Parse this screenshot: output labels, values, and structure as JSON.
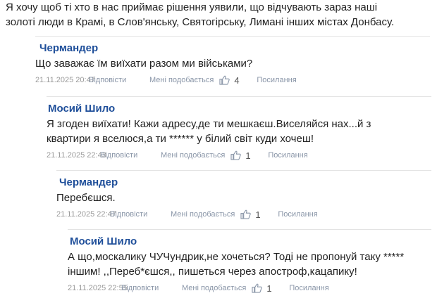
{
  "intro": {
    "line1": "Я хочу щоб ті хто в нас приймає рішення уявили, що відчувають зараз наші",
    "line2": "золоті люди в Крамі, в Слов'янську, Святогірську, Лимані інших містах Донбасу."
  },
  "comments": [
    {
      "author": "Чермандер",
      "lines": [
        "Що заважає їм виїхати разом ми військами?"
      ],
      "date": "21.11.2025 20:47",
      "reply": "Відповісти",
      "like": "Мені подобається",
      "likes": "4",
      "link": "Посилання"
    },
    {
      "author": "Мосий Шило",
      "lines": [
        "Я згоден виїхати! Кажи адресу,де ти мешкаєш.Виселяйся нах...й з",
        "квартири я вселюся,а ти ****** у білий світ куди хочеш!"
      ],
      "date": "21.11.2025 22:43",
      "reply": "Відповісти",
      "like": "Мені подобається",
      "likes": "1",
      "link": "Посилання"
    },
    {
      "author": "Чермандер",
      "lines": [
        "Перебєшся."
      ],
      "date": "21.11.2025 22:47",
      "reply": "Відповісти",
      "like": "Мені подобається",
      "likes": "1",
      "link": "Посилання"
    },
    {
      "author": "Мосий Шило",
      "lines": [
        "А що,москалику ЧУЧундрик,не хочеться? Тоді не пропонуй таку *****",
        "іншим! ,,Переб*єшся,, пишеться через апостроф,кацапику!"
      ],
      "date": "21.11.2025 22:55",
      "reply": "Відповісти",
      "like": "Мені подобається",
      "likes": "1",
      "link": "Посилання"
    }
  ],
  "icons": {
    "like": "thumbs-up-icon"
  },
  "colors": {
    "author": "#1f4f9a",
    "meta": "#9a9a9a",
    "divider": "#e3e3e3"
  }
}
